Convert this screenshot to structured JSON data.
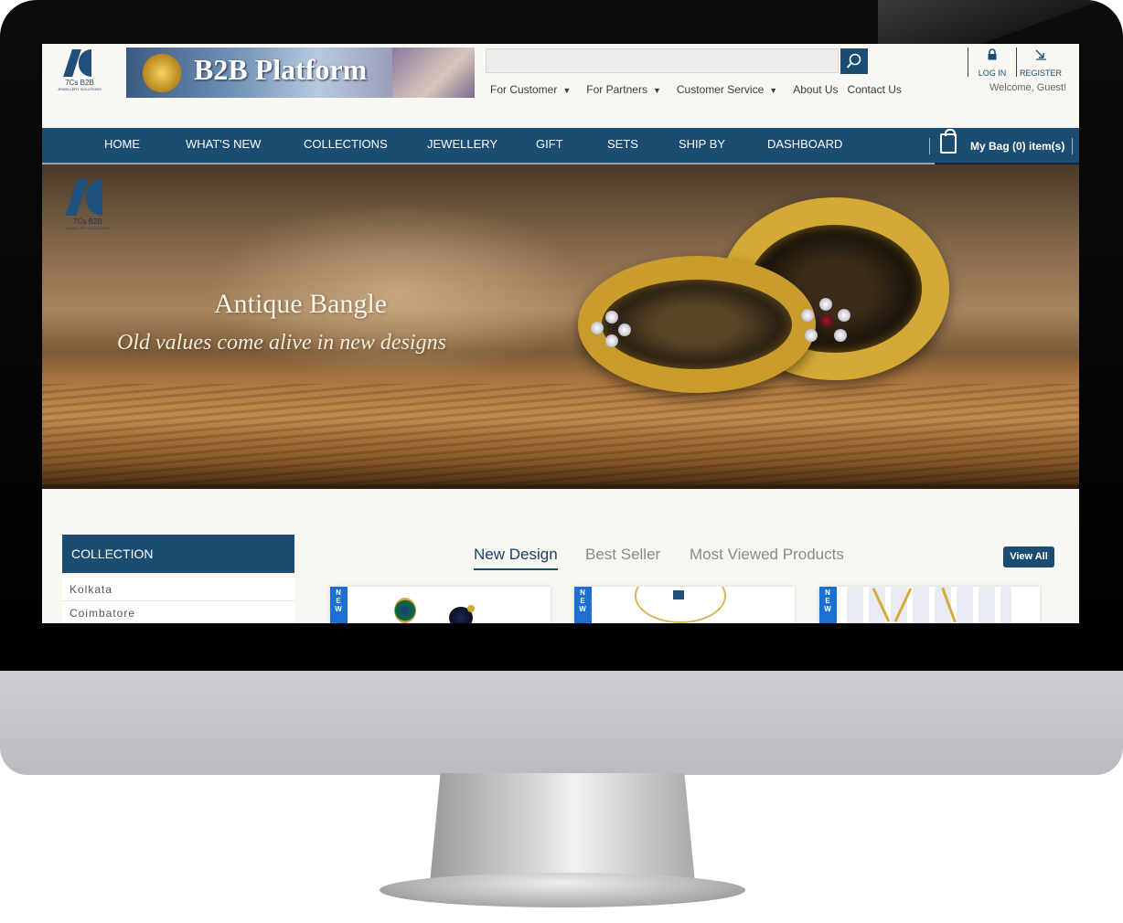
{
  "header": {
    "logo_text": "7Cs B2B",
    "logo_subtext": "JEWELLERY SOLUTIONS",
    "banner_title": "B2B Platform",
    "search": {
      "placeholder": "",
      "value": ""
    },
    "top_links": [
      {
        "label": "For Customer",
        "caret": "▼"
      },
      {
        "label": "For Partners",
        "caret": "▼"
      },
      {
        "label": "Customer Service",
        "caret": "▼"
      },
      {
        "label": "About Us",
        "caret": ""
      },
      {
        "label": "Contact Us",
        "caret": ""
      }
    ],
    "login_label": "LOG IN",
    "register_label": "REGISTER",
    "welcome": "Welcome, Guest!"
  },
  "nav": {
    "items": [
      "HOME",
      "WHAT'S NEW",
      "COLLECTIONS",
      "JEWELLERY",
      "GIFT",
      "SETS",
      "SHIP BY",
      "DASHBOARD"
    ],
    "bag_label": "My Bag (0) item(s)"
  },
  "hero": {
    "logo_text": "7Cs B2B",
    "logo_subtext": "JEWELLERY SOLUTIONS",
    "title": "Antique Bangle",
    "subtitle": "Old values come alive in new designs"
  },
  "sidebar": {
    "heading": "COLLECTION",
    "items": [
      "Kolkata",
      "Coimbatore"
    ]
  },
  "tabs": {
    "items": [
      "New Design",
      "Best Seller",
      "Most Viewed Products"
    ],
    "active": "New Design",
    "view_all": "View All"
  },
  "products": {
    "badge": "NEW"
  },
  "colors": {
    "brand_navy": "#1b4c72",
    "badge_blue": "#1d6fd1",
    "page_bg": "#f8f7f2"
  }
}
